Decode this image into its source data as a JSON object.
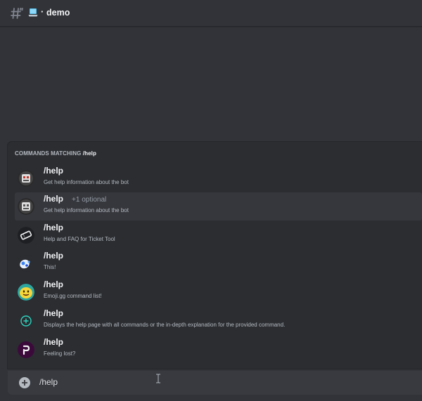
{
  "header": {
    "channel_emoji": "laptop-icon",
    "channel_separator": "·",
    "channel_name": "demo"
  },
  "popup": {
    "title_prefix": "COMMANDS MATCHING",
    "title_query": "/help",
    "commands": [
      {
        "name": "/help",
        "optional": "",
        "description": "Get help information about the bot",
        "avatar": "robot-bot-avatar"
      },
      {
        "name": "/help",
        "optional": "+1 optional",
        "description": "Get help information about the bot",
        "avatar": "robot-bot-avatar"
      },
      {
        "name": "/help",
        "optional": "",
        "description": "Help and FAQ for Ticket Tool",
        "avatar": "ticket-tool-avatar"
      },
      {
        "name": "/help",
        "optional": "",
        "description": "This!",
        "avatar": "blue-white-bot-avatar"
      },
      {
        "name": "/help",
        "optional": "",
        "description": "Emoji.gg command list!",
        "avatar": "emoji-gg-avatar"
      },
      {
        "name": "/help",
        "optional": "",
        "description": "Displays the help page with all commands or the in-depth explanation for the provided command.",
        "avatar": "plus-circle-bot-avatar"
      },
      {
        "name": "/help",
        "optional": "",
        "description": "Feeling lost?",
        "avatar": "purple-p-avatar"
      }
    ]
  },
  "input": {
    "value": "/help"
  },
  "colors": {
    "background": "#313338",
    "popup": "#2b2d31",
    "selected_row": "#36373d",
    "input_bar": "#383a40"
  }
}
